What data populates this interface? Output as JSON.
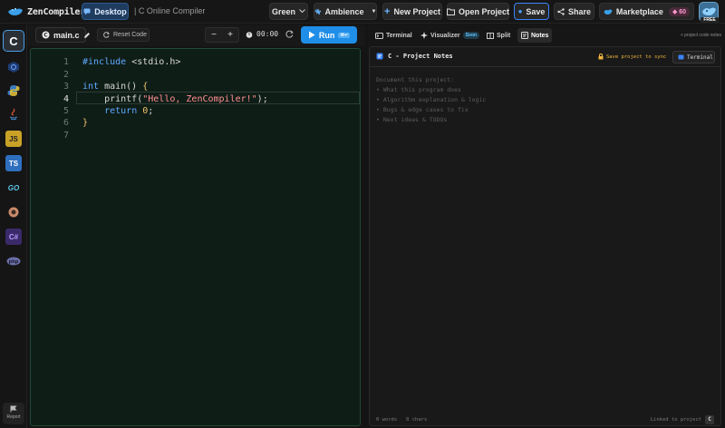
{
  "topbar": {
    "logo_text": "ZenCompiler",
    "desktop_label": "Desktop",
    "subtitle": "| C Online Compiler",
    "theme_label": "Green",
    "ambience_label": "Ambience",
    "new_project_label": "New Project",
    "open_project_label": "Open Project",
    "save_label": "Save",
    "share_label": "Share",
    "marketplace_label": "Marketplace",
    "marketplace_count": "60",
    "plan_badge": "FREE"
  },
  "sidebar": {
    "languages": [
      {
        "name": "C",
        "icon": "c-lang-icon"
      },
      {
        "name": "C++",
        "icon": "cpp-icon"
      },
      {
        "name": "Python",
        "icon": "python-icon"
      },
      {
        "name": "Java",
        "icon": "java-icon"
      },
      {
        "name": "JavaScript",
        "icon": "js-icon",
        "glyph": "JS"
      },
      {
        "name": "TypeScript",
        "icon": "ts-icon",
        "glyph": "TS"
      },
      {
        "name": "Go",
        "icon": "go-icon",
        "glyph": "GO"
      },
      {
        "name": "Rust",
        "icon": "rust-icon"
      },
      {
        "name": "C#",
        "icon": "csharp-icon",
        "glyph": "C#"
      },
      {
        "name": "PHP",
        "icon": "php-icon",
        "glyph": "php"
      }
    ],
    "report_label": "Report"
  },
  "editor_toolbar": {
    "file_name": "main.c",
    "reset_label": "Reset Code",
    "zoom_out": "−",
    "zoom_in": "+",
    "timer": "00:00",
    "run_label": "Run",
    "run_shortcut": "⌘↵"
  },
  "editor": {
    "active_line": 4,
    "lines": [
      {
        "no": "1",
        "text": "#include <stdio.h>"
      },
      {
        "no": "2",
        "text": ""
      },
      {
        "no": "3",
        "text": "int main() {"
      },
      {
        "no": "4",
        "text": "    printf(\"Hello, ZenCompiler!\");"
      },
      {
        "no": "5",
        "text": "    return 0;"
      },
      {
        "no": "6",
        "text": "}"
      },
      {
        "no": "7",
        "text": ""
      }
    ]
  },
  "right_tabs": {
    "terminal": "Terminal",
    "visualizer": "Visualizer",
    "visualizer_badge": "Soon",
    "split": "Split",
    "notes": "Notes",
    "side_note": "+ project code notes"
  },
  "notes": {
    "title": "C - Project Notes",
    "sync_hint": "Save project to sync",
    "terminal_button": "Terminal",
    "placeholder_lines": [
      "Document this project:",
      "• What this program does",
      "• Algorithm explanation & logic",
      "• Bugs & edge cases to fix",
      "• Next ideas & TODOs"
    ],
    "word_count": "0 words",
    "char_count": "0 chars",
    "linked_label": "Linked to project",
    "linked_lang": "C"
  },
  "colors": {
    "accent": "#1f8ee8",
    "editor_bg": "#0f1d17",
    "sync_warning": "#f0b53c"
  }
}
